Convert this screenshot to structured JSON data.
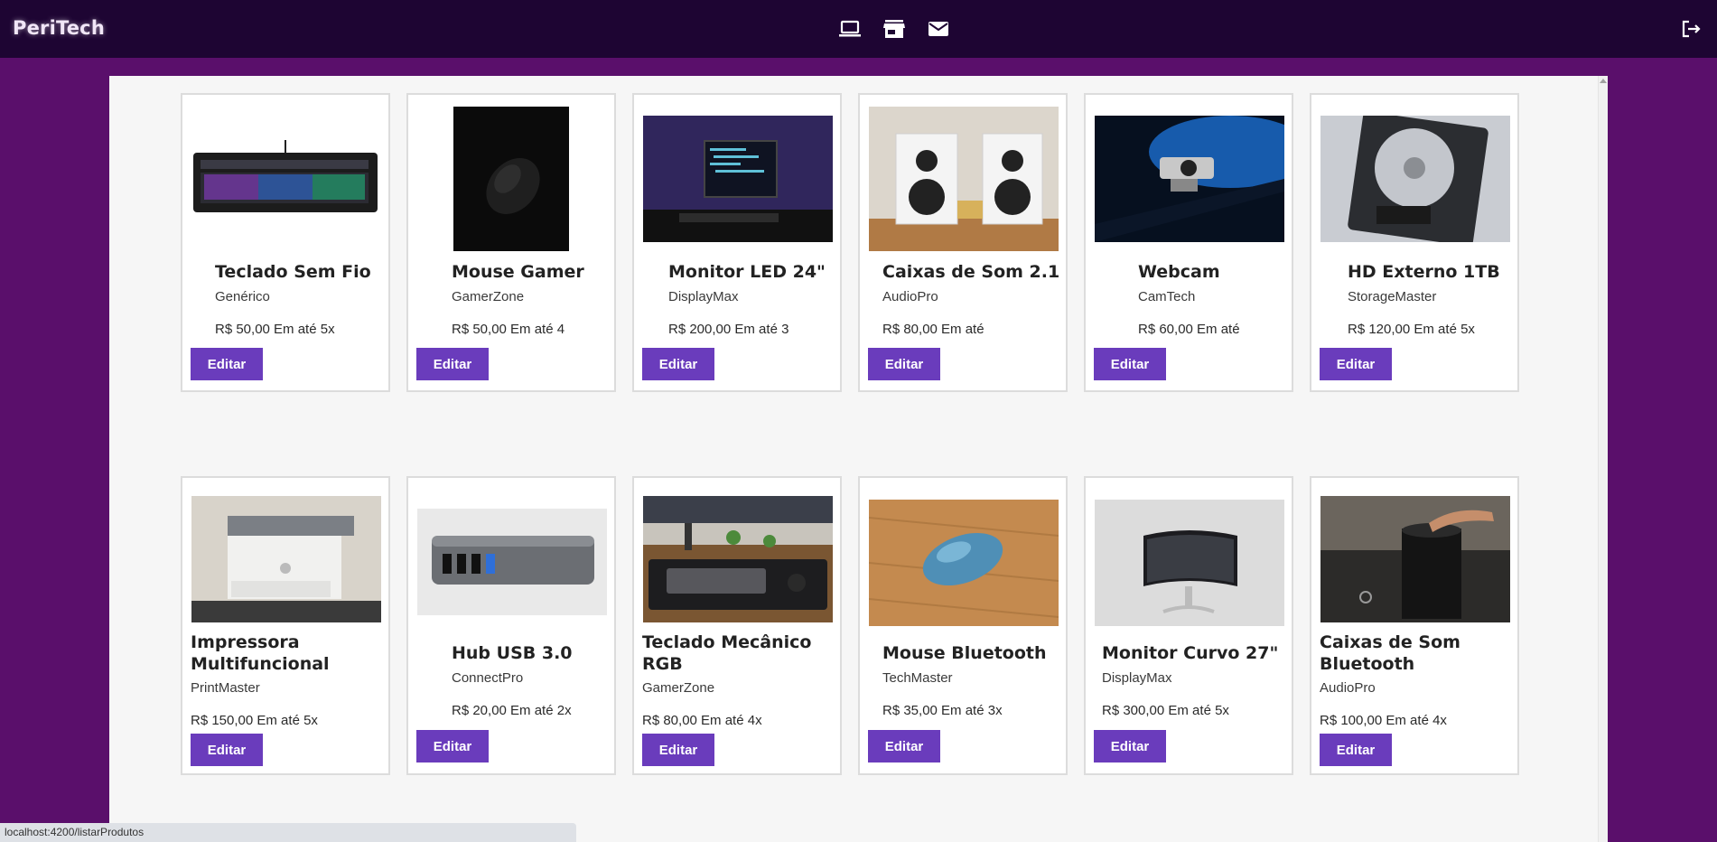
{
  "app": {
    "brand": "PeriTech"
  },
  "nav": {
    "icons": [
      "laptop-icon",
      "store-icon",
      "mail-icon",
      "logout-icon"
    ]
  },
  "colors": {
    "topbar": "#1e0533",
    "page": "#5a0f6b",
    "button": "#6a3cbc"
  },
  "products": [
    {
      "title": "Teclado Sem Fio",
      "brand": "Genérico",
      "price": "R$ 50,00 Em até 5x",
      "button": "Editar"
    },
    {
      "title": "Mouse Gamer",
      "brand": "GamerZone",
      "price": "R$ 50,00 Em até 4",
      "button": "Editar"
    },
    {
      "title": "Monitor LED 24\"",
      "brand": "DisplayMax",
      "price": "R$ 200,00 Em até 3",
      "button": "Editar"
    },
    {
      "title": "Caixas de Som 2.1",
      "brand": "AudioPro",
      "price": "R$ 80,00 Em até",
      "button": "Editar"
    },
    {
      "title": "Webcam",
      "brand": "CamTech",
      "price": "R$ 60,00 Em até",
      "button": "Editar"
    },
    {
      "title": "HD Externo 1TB",
      "brand": "StorageMaster",
      "price": "R$ 120,00 Em até 5x",
      "button": "Editar"
    },
    {
      "title": "Impressora Multifuncional",
      "brand": "PrintMaster",
      "price": "R$ 150,00 Em até 5x",
      "button": "Editar"
    },
    {
      "title": "Hub USB 3.0",
      "brand": "ConnectPro",
      "price": "R$ 20,00 Em até 2x",
      "button": "Editar"
    },
    {
      "title": "Teclado Mecânico RGB",
      "brand": "GamerZone",
      "price": "R$ 80,00 Em até 4x",
      "button": "Editar"
    },
    {
      "title": "Mouse Bluetooth",
      "brand": "TechMaster",
      "price": "R$ 35,00 Em até 3x",
      "button": "Editar"
    },
    {
      "title": "Monitor Curvo 27\"",
      "brand": "DisplayMax",
      "price": "R$ 300,00 Em até 5x",
      "button": "Editar"
    },
    {
      "title": "Caixas de Som Bluetooth",
      "brand": "AudioPro",
      "price": "R$ 100,00 Em até 4x",
      "button": "Editar"
    }
  ],
  "status_bar": {
    "url": "localhost:4200/listarProdutos"
  }
}
